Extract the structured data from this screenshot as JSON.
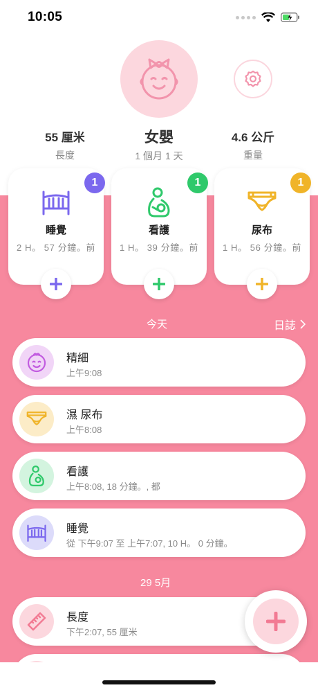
{
  "status_bar": {
    "time": "10:05"
  },
  "profile": {
    "length_value": "55 厘米",
    "length_label": "長度",
    "name": "女嬰",
    "age": "1 個月 1 天",
    "weight_value": "4.6 公斤",
    "weight_label": "重量"
  },
  "trackers": [
    {
      "title": "睡覺",
      "subtitle": "2 H。 57 分鐘。前",
      "badge": "1",
      "icon": "crib-icon",
      "color": "#7b68ee"
    },
    {
      "title": "看護",
      "subtitle": "1 H。 39 分鐘。前",
      "badge": "1",
      "icon": "nursing-icon",
      "color": "#2fc96b"
    },
    {
      "title": "尿布",
      "subtitle": "1 H。 56 分鐘。前",
      "badge": "1",
      "icon": "diaper-icon",
      "color": "#f0b429"
    }
  ],
  "today_section": {
    "title": "今天",
    "log_label": "日誌"
  },
  "today_entries": [
    {
      "title": "精細",
      "subtitle": "上午9:08",
      "icon": "baby-face-icon",
      "icon_bg": "#f1d5f7"
    },
    {
      "title": "濕 尿布",
      "subtitle": "上午8:08",
      "icon": "diaper-icon",
      "icon_bg": "#fcecc7"
    },
    {
      "title": "看護",
      "subtitle": "上午8:08, 18 分鐘。, 都",
      "icon": "nursing-icon",
      "icon_bg": "#d3f4df"
    },
    {
      "title": "睡覺",
      "subtitle": "從 下午9:07 至 上午7:07, 10 H。 0 分鐘。",
      "icon": "crib-icon",
      "icon_bg": "#dcdbfa"
    }
  ],
  "past_section": {
    "title": "29 5月"
  },
  "past_entries": [
    {
      "title": "長度",
      "subtitle": "下午2:07, 55 厘米",
      "icon": "ruler-icon",
      "icon_bg": "#fcd7de"
    }
  ],
  "colors": {
    "accent": "#f7889e",
    "avatar_bg": "#fcd7de",
    "brand_pink": "#f294ac"
  }
}
